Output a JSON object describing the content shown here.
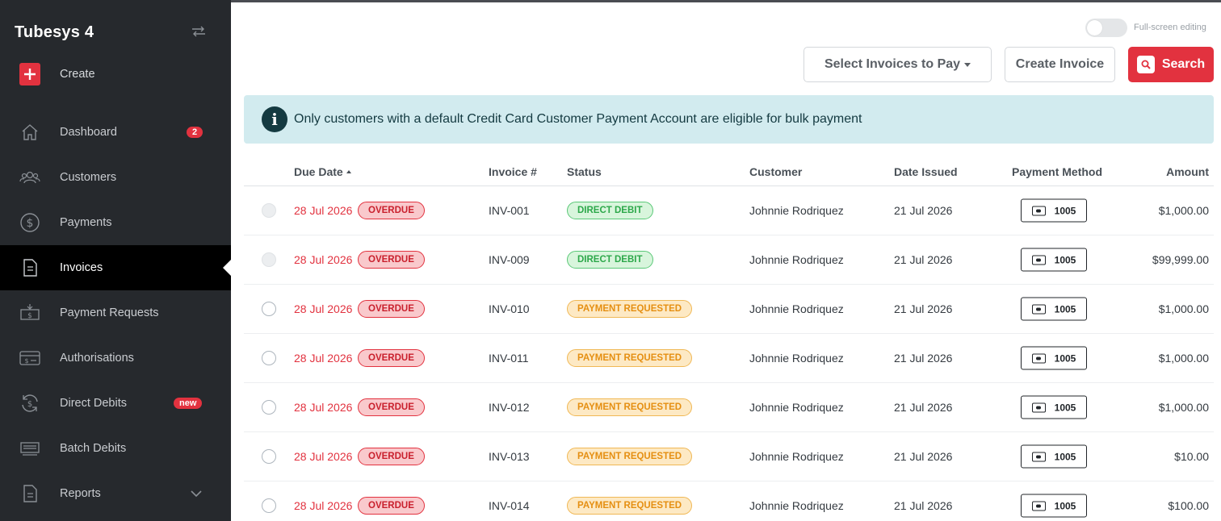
{
  "app": {
    "title": "Tubesys 4"
  },
  "sidebar": {
    "create_label": "Create",
    "items": [
      {
        "label": "Dashboard",
        "icon": "home-icon",
        "badge": "2"
      },
      {
        "label": "Customers",
        "icon": "users-icon"
      },
      {
        "label": "Payments",
        "icon": "dollar-circle-icon"
      },
      {
        "label": "Invoices",
        "icon": "document-icon",
        "active": true
      },
      {
        "label": "Payment Requests",
        "icon": "money-request-icon"
      },
      {
        "label": "Authorisations",
        "icon": "card-dollar-icon"
      },
      {
        "label": "Direct Debits",
        "icon": "recurring-dollar-icon",
        "badge": "new"
      },
      {
        "label": "Batch Debits",
        "icon": "batch-icon"
      },
      {
        "label": "Reports",
        "icon": "report-icon"
      }
    ]
  },
  "toolbar": {
    "fullscreen_label": "Full-screen editing",
    "select_label": "Select Invoices to Pay",
    "create_label": "Create Invoice",
    "search_label": "Search"
  },
  "alert": {
    "message": "Only customers with a default Credit Card Customer Payment Account are eligible for bulk payment"
  },
  "table": {
    "columns": [
      "Due Date",
      "Invoice #",
      "Status",
      "Customer",
      "Date Issued",
      "Payment Method",
      "Amount"
    ],
    "rows": [
      {
        "due": "28 Jul 2026",
        "flag": "OVERDUE",
        "invoice": "INV-001",
        "status": "DIRECT DEBIT",
        "customer": "Johnnie Rodriquez",
        "issued": "21 Jul 2026",
        "card": "1005",
        "amount": "$1,000.00"
      },
      {
        "due": "28 Jul 2026",
        "flag": "OVERDUE",
        "invoice": "INV-009",
        "status": "DIRECT DEBIT",
        "customer": "Johnnie Rodriquez",
        "issued": "21 Jul 2026",
        "card": "1005",
        "amount": "$99,999.00"
      },
      {
        "due": "28 Jul 2026",
        "flag": "OVERDUE",
        "invoice": "INV-010",
        "status": "PAYMENT REQUESTED",
        "customer": "Johnnie Rodriquez",
        "issued": "21 Jul 2026",
        "card": "1005",
        "amount": "$1,000.00"
      },
      {
        "due": "28 Jul 2026",
        "flag": "OVERDUE",
        "invoice": "INV-011",
        "status": "PAYMENT REQUESTED",
        "customer": "Johnnie Rodriquez",
        "issued": "21 Jul 2026",
        "card": "1005",
        "amount": "$1,000.00"
      },
      {
        "due": "28 Jul 2026",
        "flag": "OVERDUE",
        "invoice": "INV-012",
        "status": "PAYMENT REQUESTED",
        "customer": "Johnnie Rodriquez",
        "issued": "21 Jul 2026",
        "card": "1005",
        "amount": "$1,000.00"
      },
      {
        "due": "28 Jul 2026",
        "flag": "OVERDUE",
        "invoice": "INV-013",
        "status": "PAYMENT REQUESTED",
        "customer": "Johnnie Rodriquez",
        "issued": "21 Jul 2026",
        "card": "1005",
        "amount": "$10.00"
      },
      {
        "due": "28 Jul 2026",
        "flag": "OVERDUE",
        "invoice": "INV-014",
        "status": "PAYMENT REQUESTED",
        "customer": "Johnnie Rodriquez",
        "issued": "21 Jul 2026",
        "card": "1005",
        "amount": "$100.00"
      }
    ]
  },
  "colors": {
    "accent": "#e2323f",
    "sidebar_bg": "#26292d",
    "alert_bg": "#d2ebef"
  }
}
